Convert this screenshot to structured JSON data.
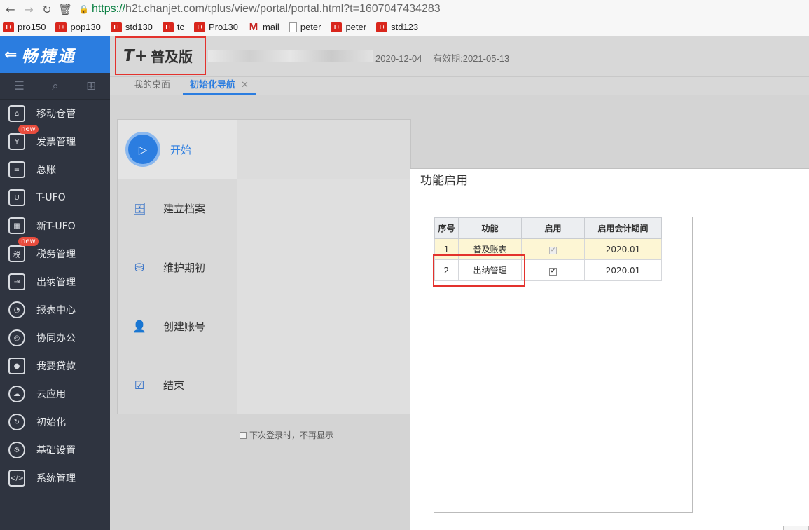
{
  "browser": {
    "url_scheme": "https://",
    "url_rest": "h2t.chanjet.com/tplus/view/portal/portal.html?t=1607047434283",
    "bookmarks": [
      {
        "label": "pro150",
        "icon": "T+"
      },
      {
        "label": "pop130",
        "icon": "T+"
      },
      {
        "label": "std130",
        "icon": "T+"
      },
      {
        "label": "tc",
        "icon": "T+"
      },
      {
        "label": "Pro130",
        "icon": "T+"
      },
      {
        "label": "mail",
        "icon": "M"
      },
      {
        "label": "peter",
        "icon": "doc"
      },
      {
        "label": "peter",
        "icon": "T+"
      },
      {
        "label": "std123",
        "icon": "T+"
      }
    ]
  },
  "sidebar": {
    "brand": "畅捷通",
    "items": [
      {
        "label": "移动仓管",
        "icon": "warehouse-icon",
        "badge": ""
      },
      {
        "label": "发票管理",
        "icon": "invoice-icon",
        "badge": "new"
      },
      {
        "label": "总账",
        "icon": "ledger-icon",
        "badge": ""
      },
      {
        "label": "T-UFO",
        "icon": "ufo-icon",
        "badge": ""
      },
      {
        "label": "新T-UFO",
        "icon": "new-ufo-icon",
        "badge": ""
      },
      {
        "label": "税务管理",
        "icon": "tax-icon",
        "badge": "new"
      },
      {
        "label": "出纳管理",
        "icon": "cashier-icon",
        "badge": ""
      },
      {
        "label": "报表中心",
        "icon": "report-icon",
        "badge": ""
      },
      {
        "label": "协同办公",
        "icon": "collaboration-icon",
        "badge": ""
      },
      {
        "label": "我要贷款",
        "icon": "loan-icon",
        "badge": ""
      },
      {
        "label": "云应用",
        "icon": "cloud-icon",
        "badge": ""
      },
      {
        "label": "初始化",
        "icon": "init-icon",
        "badge": ""
      },
      {
        "label": "基础设置",
        "icon": "settings-icon",
        "badge": ""
      },
      {
        "label": "系统管理",
        "icon": "system-icon",
        "badge": ""
      }
    ]
  },
  "header": {
    "logo_tplus": "T+",
    "logo_edition": "普及版",
    "date": "2020-12-04",
    "validity": "有效期:2021-05-13"
  },
  "tabs": [
    {
      "label": "我的桌面",
      "active": false
    },
    {
      "label": "初始化导航",
      "active": true
    }
  ],
  "guide": {
    "steps": [
      "开始",
      "建立档案",
      "维护期初",
      "创建账号",
      "结束"
    ],
    "noshow_label": "下次登录时，不再显示"
  },
  "modal": {
    "title": "功能启用",
    "columns": [
      "序号",
      "功能",
      "启用",
      "启用会计期间"
    ],
    "rows": [
      {
        "no": "1",
        "func": "普及账表",
        "enabled": true,
        "period": "2020.01"
      },
      {
        "no": "2",
        "func": "出纳管理",
        "enabled": true,
        "period": "2020.01"
      }
    ]
  },
  "colors": {
    "accent": "#2b7de0",
    "sidebar_bg": "#2f3440",
    "highlight_red": "#e3322d"
  }
}
